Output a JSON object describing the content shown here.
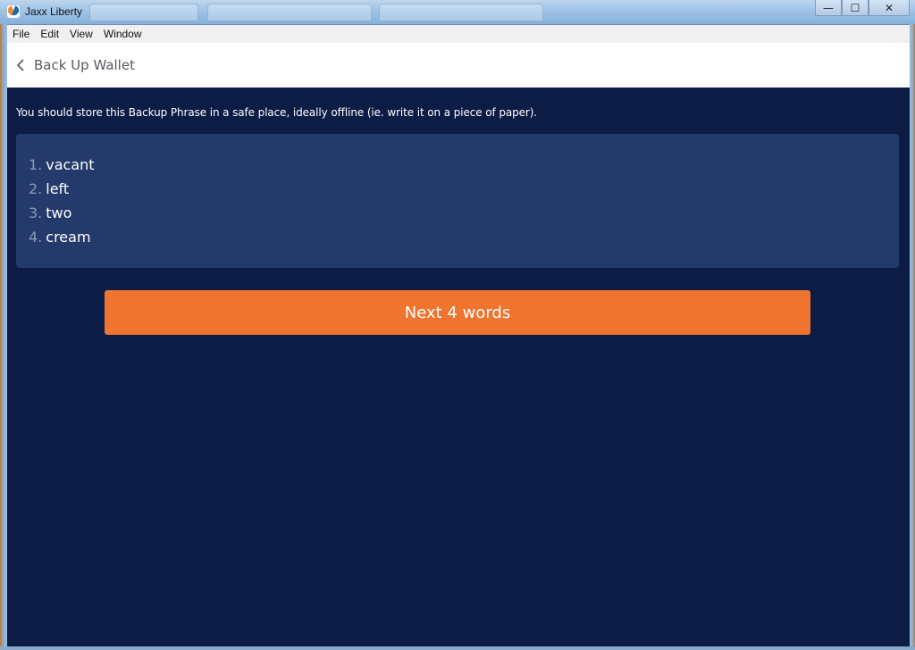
{
  "window": {
    "title": "Jaxx Liberty",
    "controls": {
      "minimize": "—",
      "maximize": "☐",
      "close": "✕"
    }
  },
  "menu": {
    "items": [
      "File",
      "Edit",
      "View",
      "Window"
    ]
  },
  "header": {
    "back_icon": "chevron-left-icon",
    "title": "Back Up Wallet"
  },
  "main": {
    "instruction": "You should store this Backup Phrase in a safe place, ideally offline (ie. write it on a piece of paper).",
    "phrase": [
      {
        "num": "1.",
        "word": "vacant"
      },
      {
        "num": "2.",
        "word": "left"
      },
      {
        "num": "3.",
        "word": "two"
      },
      {
        "num": "4.",
        "word": "cream"
      }
    ],
    "next_button": "Next 4 words"
  },
  "colors": {
    "background": "#0c1c45",
    "phrase_box": "#233a6a",
    "accent": "#ee7430",
    "number_muted": "#8a9ab5"
  }
}
